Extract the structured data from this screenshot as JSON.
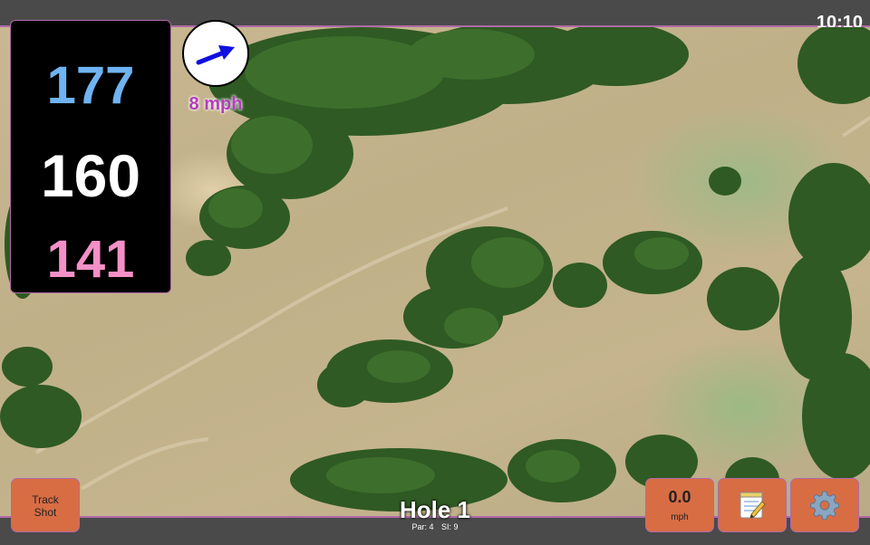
{
  "status": {
    "time": "10:10"
  },
  "yardage": {
    "back": "177",
    "middle": "160",
    "front": "141"
  },
  "wind": {
    "speed": "8 mph",
    "arrow_icon": "wind-arrow-icon",
    "arrow_color": "#1010e0"
  },
  "hole": {
    "title": "Hole 1",
    "par_label": "Par: 4",
    "si_label": "SI: 9"
  },
  "buttons": {
    "track_shot_line1": "Track",
    "track_shot_line2": "Shot",
    "speed_value": "0.0",
    "speed_unit": "mph",
    "notes_icon": "notepad-icon",
    "settings_icon": "gear-icon"
  },
  "colors": {
    "back": "#6fb3f2",
    "middle": "#ffffff",
    "front": "#f590c7",
    "button": "#d86d44",
    "accent": "#b06aa8",
    "wind_text": "#b43dba"
  }
}
